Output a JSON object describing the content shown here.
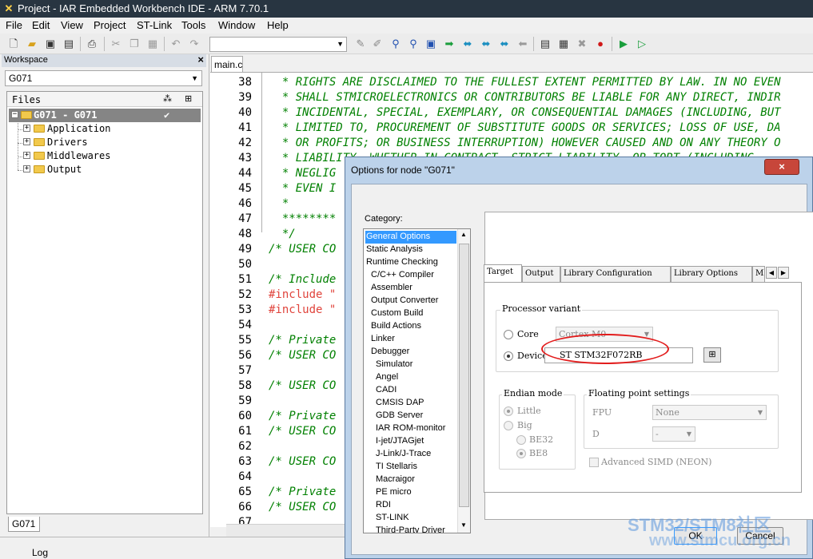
{
  "window": {
    "title": "Project - IAR Embedded Workbench IDE - ARM 7.70.1",
    "icon": "iar-logo-icon"
  },
  "menu": [
    "File",
    "Edit",
    "View",
    "Project",
    "ST-Link",
    "Tools",
    "Window",
    "Help"
  ],
  "toolbar": {
    "icons": [
      "new-file-icon",
      "open-folder-icon",
      "save-icon",
      "save-all-icon",
      "print-icon",
      "cut-icon",
      "copy-icon",
      "paste-icon",
      "undo-icon",
      "redo-icon"
    ],
    "combo_value": "",
    "right_icons": [
      "toggle-breakpoint-icon",
      "bookmark-icon",
      "find-icon",
      "find-next-icon",
      "goto-icon",
      "nav-forward-icon",
      "nav-back-icon",
      "nav-next-icon",
      "nav-prev-icon",
      "nav-back-alt-icon",
      "compile-icon",
      "make-icon",
      "stop-build-icon",
      "breakpoint-icon",
      "debug-icon",
      "debug-no-download-icon"
    ]
  },
  "workspace": {
    "header": "Workspace",
    "close": "×",
    "config": "G071",
    "files_header": "Files",
    "tree": [
      {
        "label": "G071 - G071",
        "selected": true,
        "check": "✔"
      },
      {
        "label": "Application"
      },
      {
        "label": "Drivers"
      },
      {
        "label": "Middlewares"
      },
      {
        "label": "Output"
      }
    ],
    "bottom_tab": "G071"
  },
  "editor": {
    "tab": "main.c",
    "lines": [
      {
        "n": "38",
        "text": "  * RIGHTS ARE DISCLAIMED TO THE FULLEST EXTENT PERMITTED BY LAW. IN NO EVEN"
      },
      {
        "n": "39",
        "text": "  * SHALL STMICROELECTRONICS OR CONTRIBUTORS BE LIABLE FOR ANY DIRECT, INDIR"
      },
      {
        "n": "40",
        "text": "  * INCIDENTAL, SPECIAL, EXEMPLARY, OR CONSEQUENTIAL DAMAGES (INCLUDING, BUT"
      },
      {
        "n": "41",
        "text": "  * LIMITED TO, PROCUREMENT OF SUBSTITUTE GOODS OR SERVICES; LOSS OF USE, DA"
      },
      {
        "n": "42",
        "text": "  * OR PROFITS; OR BUSINESS INTERRUPTION) HOWEVER CAUSED AND ON ANY THEORY O"
      },
      {
        "n": "43",
        "text": "  * LIABILITY, WHETHER IN CONTRACT, STRICT LIABILITY, OR TORT (INCLUDING"
      },
      {
        "n": "44",
        "text": "  * NEGLIG"
      },
      {
        "n": "45",
        "text": "  * EVEN I"
      },
      {
        "n": "46",
        "text": "  *"
      },
      {
        "n": "47",
        "text": "  ********"
      },
      {
        "n": "48",
        "text": "  */"
      },
      {
        "n": "49",
        "text": "/* USER CO"
      },
      {
        "n": "50",
        "text": ""
      },
      {
        "n": "51",
        "text": "/* Include"
      },
      {
        "n": "52",
        "text": "#include \"",
        "pp": true
      },
      {
        "n": "53",
        "text": "#include \"",
        "pp": true
      },
      {
        "n": "54",
        "text": ""
      },
      {
        "n": "55",
        "text": "/* Private"
      },
      {
        "n": "56",
        "text": "/* USER CO"
      },
      {
        "n": "57",
        "text": ""
      },
      {
        "n": "58",
        "text": "/* USER CO"
      },
      {
        "n": "59",
        "text": ""
      },
      {
        "n": "60",
        "text": "/* Private"
      },
      {
        "n": "61",
        "text": "/* USER CO"
      },
      {
        "n": "62",
        "text": ""
      },
      {
        "n": "63",
        "text": "/* USER CO"
      },
      {
        "n": "64",
        "text": ""
      },
      {
        "n": "65",
        "text": "/* Private"
      },
      {
        "n": "66",
        "text": "/* USER CO"
      },
      {
        "n": "67",
        "text": ""
      }
    ]
  },
  "log": {
    "label": "Log"
  },
  "dialog": {
    "title": "Options for node \"G071\"",
    "close": "×",
    "category_label": "Category:",
    "categories": [
      {
        "label": "General Options",
        "indent": 0,
        "selected": true
      },
      {
        "label": "Static Analysis",
        "indent": 0
      },
      {
        "label": "Runtime Checking",
        "indent": 0
      },
      {
        "label": "C/C++ Compiler",
        "indent": 1
      },
      {
        "label": "Assembler",
        "indent": 1
      },
      {
        "label": "Output Converter",
        "indent": 1
      },
      {
        "label": "Custom Build",
        "indent": 1
      },
      {
        "label": "Build Actions",
        "indent": 1
      },
      {
        "label": "Linker",
        "indent": 1
      },
      {
        "label": "Debugger",
        "indent": 1
      },
      {
        "label": "Simulator",
        "indent": 2
      },
      {
        "label": "Angel",
        "indent": 2
      },
      {
        "label": "CADI",
        "indent": 2
      },
      {
        "label": "CMSIS DAP",
        "indent": 2
      },
      {
        "label": "GDB Server",
        "indent": 2
      },
      {
        "label": "IAR ROM-monitor",
        "indent": 2
      },
      {
        "label": "I-jet/JTAGjet",
        "indent": 2
      },
      {
        "label": "J-Link/J-Trace",
        "indent": 2
      },
      {
        "label": "TI Stellaris",
        "indent": 2
      },
      {
        "label": "Macraigor",
        "indent": 2
      },
      {
        "label": "PE micro",
        "indent": 2
      },
      {
        "label": "RDI",
        "indent": 2
      },
      {
        "label": "ST-LINK",
        "indent": 2
      },
      {
        "label": "Third-Party Driver",
        "indent": 2
      }
    ],
    "tabs": [
      "Target",
      "Output",
      "Library Configuration",
      "Library Options",
      "MI"
    ],
    "processor_variant": {
      "title": "Processor variant",
      "core_label": "Core",
      "core_value": "Cortex-M0",
      "device_label": "Device",
      "device_value": "ST STM32F072RB",
      "device_selected": true
    },
    "endian": {
      "title": "Endian mode",
      "little": "Little",
      "big": "Big",
      "be32": "BE32",
      "be8": "BE8"
    },
    "fpu": {
      "title": "Floating point settings",
      "fpu_label": "FPU",
      "fpu_value": "None",
      "d_label": "D",
      "d_value": "-",
      "simd_label": "Advanced SIMD (NEON)"
    },
    "ok": "OK",
    "cancel": "Cancel"
  },
  "watermark": {
    "line1": "STM32/STM8社区",
    "line2": "www.stmcu.org.cn"
  }
}
